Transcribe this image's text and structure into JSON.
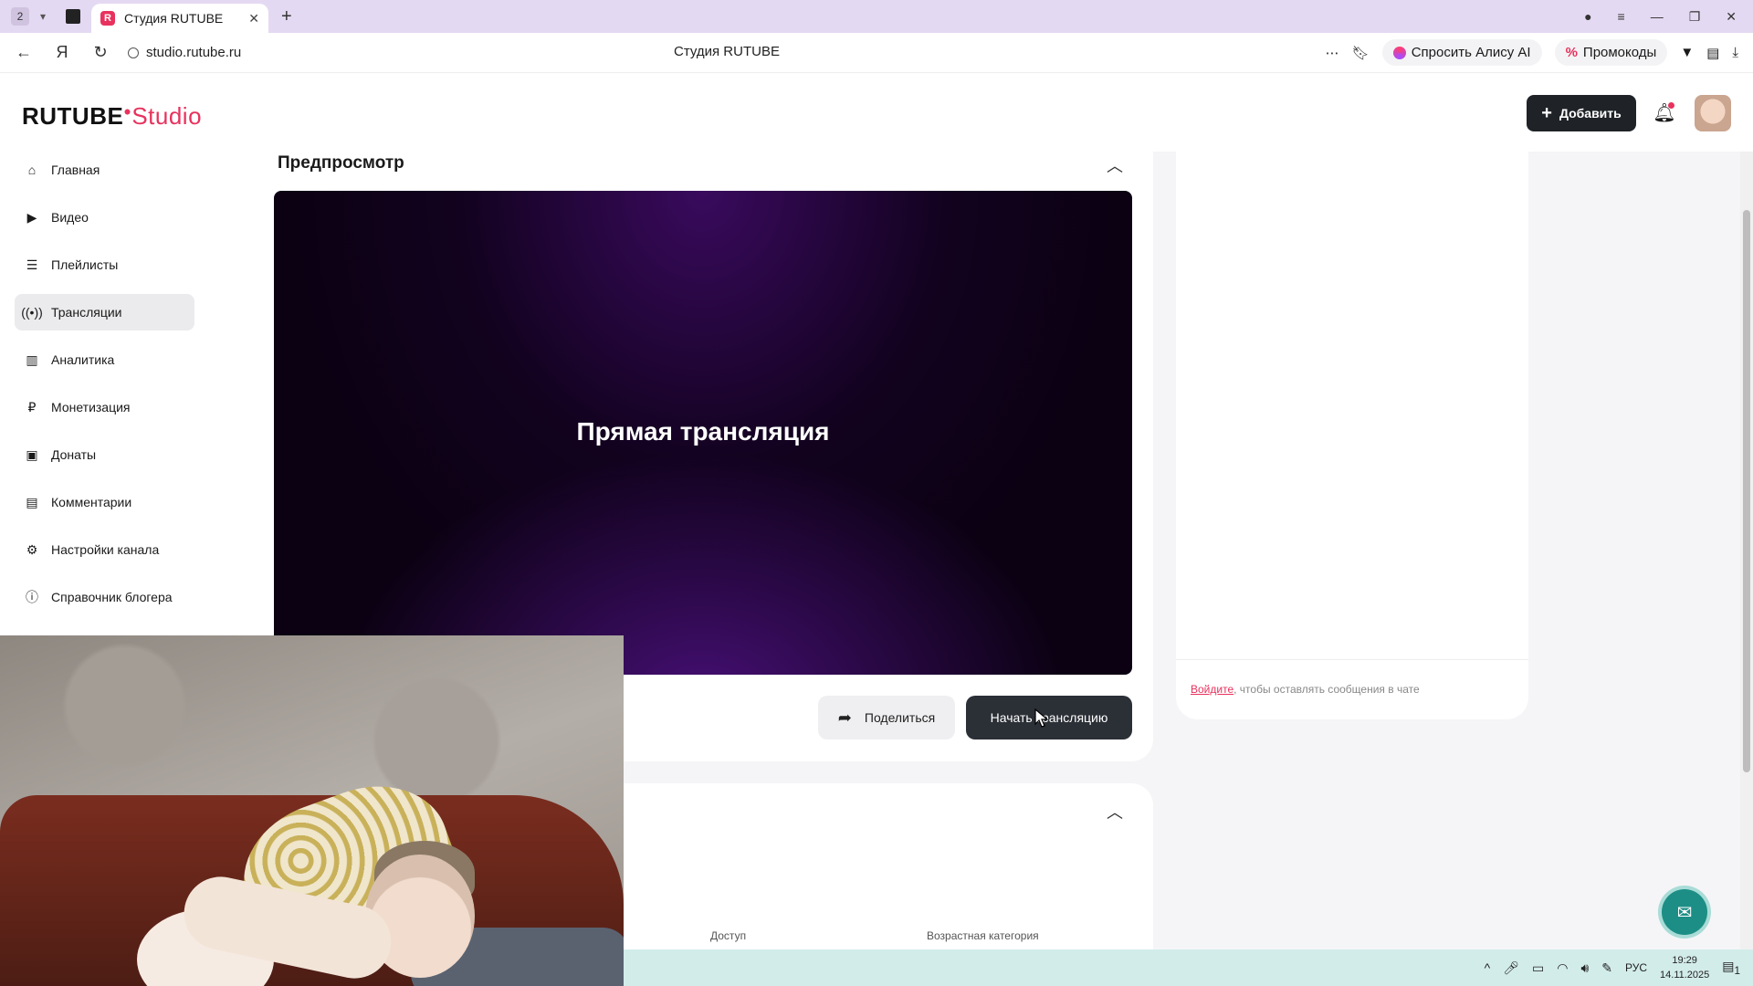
{
  "browser": {
    "tab_count": "2",
    "tab_title": "Студия RUTUBE",
    "url": "studio.rutube.ru",
    "page_title": "Студия RUTUBE",
    "alice_label": "Спросить Алису AI",
    "promo_label": "Промокоды"
  },
  "header": {
    "logo_main": "RUTUBE",
    "logo_suffix": "Studio",
    "add_label": "Добавить",
    "brand_color": "#e8325d"
  },
  "sidebar": {
    "items": [
      {
        "label": "Главная",
        "icon": "home-icon"
      },
      {
        "label": "Видео",
        "icon": "video-icon"
      },
      {
        "label": "Плейлисты",
        "icon": "playlist-icon"
      },
      {
        "label": "Трансляции",
        "icon": "broadcast-icon",
        "active": true
      },
      {
        "label": "Аналитика",
        "icon": "analytics-icon"
      },
      {
        "label": "Монетизация",
        "icon": "ruble-icon"
      },
      {
        "label": "Донаты",
        "icon": "wallet-icon"
      },
      {
        "label": "Комментарии",
        "icon": "comment-icon"
      },
      {
        "label": "Настройки канала",
        "icon": "gear-icon"
      },
      {
        "label": "Справочник блогера",
        "icon": "info-icon"
      }
    ]
  },
  "preview": {
    "title": "Предпросмотр",
    "player_title": "Прямая трансляция",
    "share_label": "Поделиться",
    "start_label": "Начать трансляцию"
  },
  "settings": {
    "access_label": "Доступ",
    "age_label": "Возрастная категория"
  },
  "chat": {
    "login_link": "Войдите",
    "login_text": ", чтобы оставлять сообщения в чате"
  },
  "taskbar": {
    "lang": "РУС",
    "time": "19:29",
    "date": "14.11.2025",
    "notif_count": "1"
  }
}
